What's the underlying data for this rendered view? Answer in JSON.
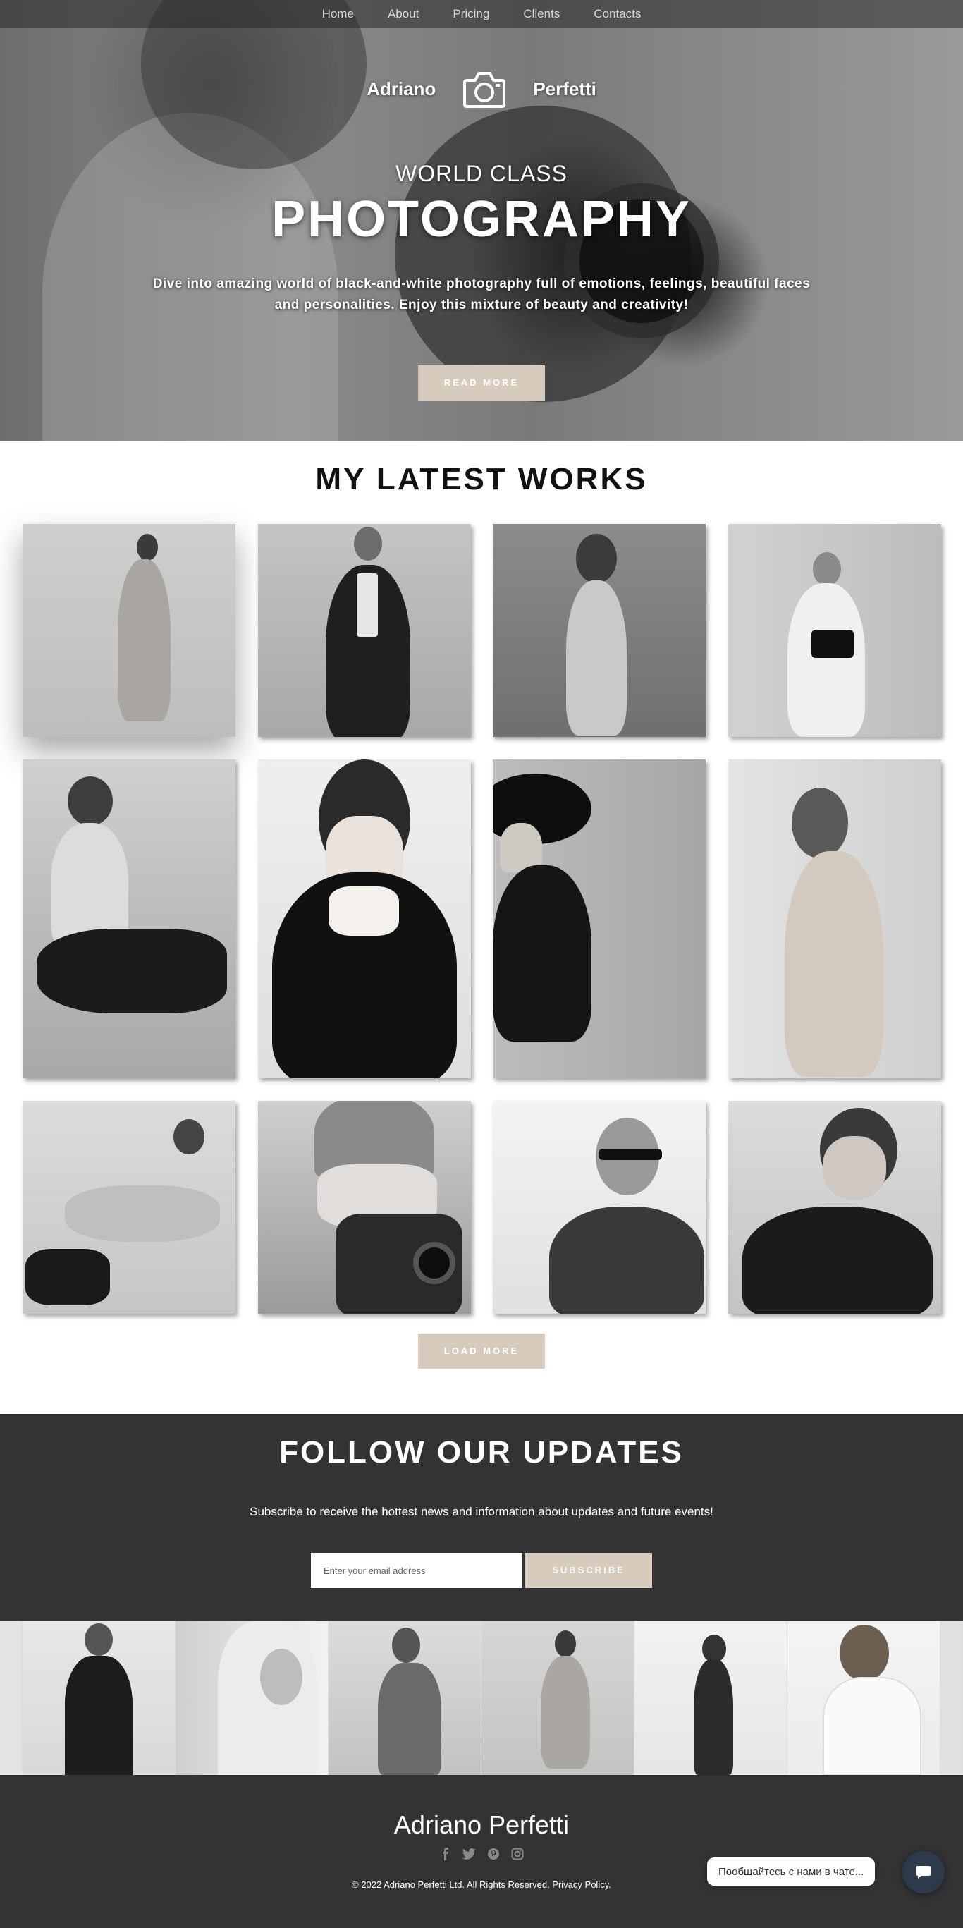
{
  "nav": {
    "items": [
      "Home",
      "About",
      "Pricing",
      "Clients",
      "Contacts"
    ]
  },
  "brand": {
    "first": "Adriano",
    "last": "Perfetti",
    "logo_icon": "camera-icon"
  },
  "hero": {
    "subtitle": "WORLD CLASS",
    "title": "PHOTOGRAPHY",
    "description": "Dive into amazing world of black-and-white photography full of emotions, feelings, beautiful faces and personalities. Enjoy this mixture of beauty and creativity!",
    "button": "READ MORE"
  },
  "works": {
    "title": "MY LATEST WORKS",
    "load_more": "LOAD MORE"
  },
  "follow": {
    "title": "FOLLOW OUR UPDATES",
    "description": "Subscribe to receive the hottest news and information about updates and future events!",
    "email_placeholder": "Enter your email address",
    "subscribe": "SUBSCRIBE"
  },
  "footer": {
    "name": "Adriano Perfetti",
    "social_icons": [
      "facebook-icon",
      "twitter-icon",
      "pinterest-icon",
      "instagram-icon"
    ],
    "copyright": "© 2022 Adriano Perfetti Ltd. All Rights Reserved. Privacy Policy."
  },
  "chat": {
    "label": "Пообщайтесь с нами в чате...",
    "icon": "chat-icon"
  },
  "colors": {
    "accent": "#d6cbbd",
    "dark": "#333335"
  }
}
